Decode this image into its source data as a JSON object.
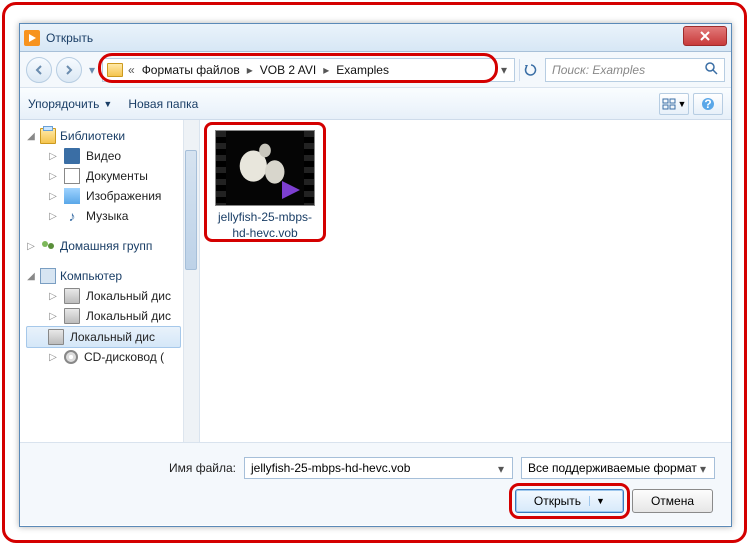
{
  "window": {
    "title": "Открыть"
  },
  "breadcrumbs": {
    "root_prefix": "«",
    "seg1": "Форматы файлов",
    "seg2": "VOB 2 AVI",
    "seg3": "Examples"
  },
  "search": {
    "placeholder": "Поиск: Examples"
  },
  "toolbar": {
    "organize": "Упорядочить",
    "new_folder": "Новая папка"
  },
  "sidebar": {
    "libraries": "Библиотеки",
    "video": "Видео",
    "documents": "Документы",
    "images": "Изображения",
    "music": "Музыка",
    "homegroup": "Домашняя групп",
    "computer": "Компьютер",
    "disk1": "Локальный дис",
    "disk2": "Локальный дис",
    "disk3": "Локальный дис",
    "cd": "CD-дисковод ("
  },
  "file": {
    "name": "jellyfish-25-mbps-hd-hevc.vob"
  },
  "bottom": {
    "filename_label": "Имя файла:",
    "filename_value": "jellyfish-25-mbps-hd-hevc.vob",
    "filter": "Все поддерживаемые формат",
    "open": "Открыть",
    "cancel": "Отмена"
  }
}
